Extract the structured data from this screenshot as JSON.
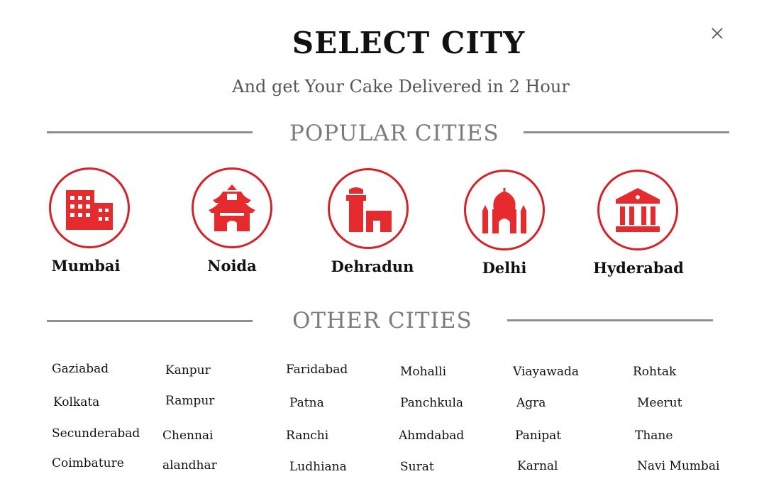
{
  "header": {
    "title": "SELECT CITY",
    "subtitle": "And get Your Cake Delivered in 2 Hour",
    "close_icon": "close-icon"
  },
  "popular": {
    "heading": "POPULAR CITIES",
    "accent_color": "#d62129",
    "cities": [
      {
        "name": "Mumbai",
        "icon": "building-icon"
      },
      {
        "name": "Noida",
        "icon": "pagoda-icon"
      },
      {
        "name": "Dehradun",
        "icon": "clock-tower-icon"
      },
      {
        "name": "Delhi",
        "icon": "taj-mahal-icon"
      },
      {
        "name": "Hyderabad",
        "icon": "museum-icon"
      }
    ]
  },
  "other": {
    "heading": "OTHER CITIES",
    "cities": [
      "Gaziabad",
      "Kanpur",
      "Faridabad",
      "Mohalli",
      "Viayawada",
      "Rohtak",
      "Kolkata",
      "Rampur",
      "Patna",
      "Panchkula",
      "Agra",
      "Meerut",
      "Secunderabad",
      "Chennai",
      "Ranchi",
      "Ahmdabad",
      "Panipat",
      "Thane",
      "Coimbature",
      "alandhar",
      "Ludhiana",
      "Surat",
      "Karnal",
      "Navi Mumbai"
    ]
  }
}
